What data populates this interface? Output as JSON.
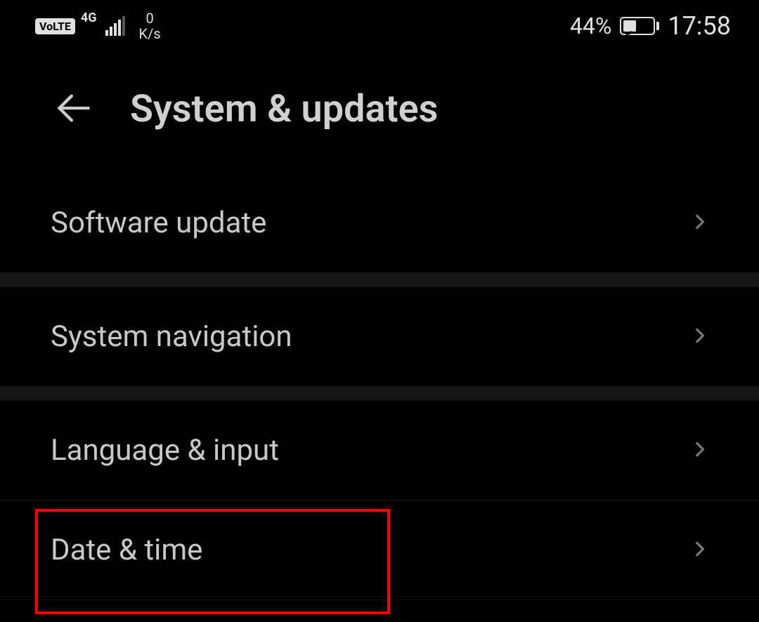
{
  "status_bar": {
    "volte": "VoLTE",
    "network": "4G",
    "data_speed_value": "0",
    "data_speed_unit": "K/s",
    "battery_pct": "44%",
    "time": "17:58"
  },
  "header": {
    "title": "System & updates"
  },
  "settings": {
    "items": [
      {
        "label": "Software update",
        "id": "software-update"
      },
      {
        "label": "System navigation",
        "id": "system-navigation"
      },
      {
        "label": "Language & input",
        "id": "language-input"
      },
      {
        "label": "Date & time",
        "id": "date-time"
      }
    ]
  },
  "highlight": {
    "target_index": 3
  }
}
